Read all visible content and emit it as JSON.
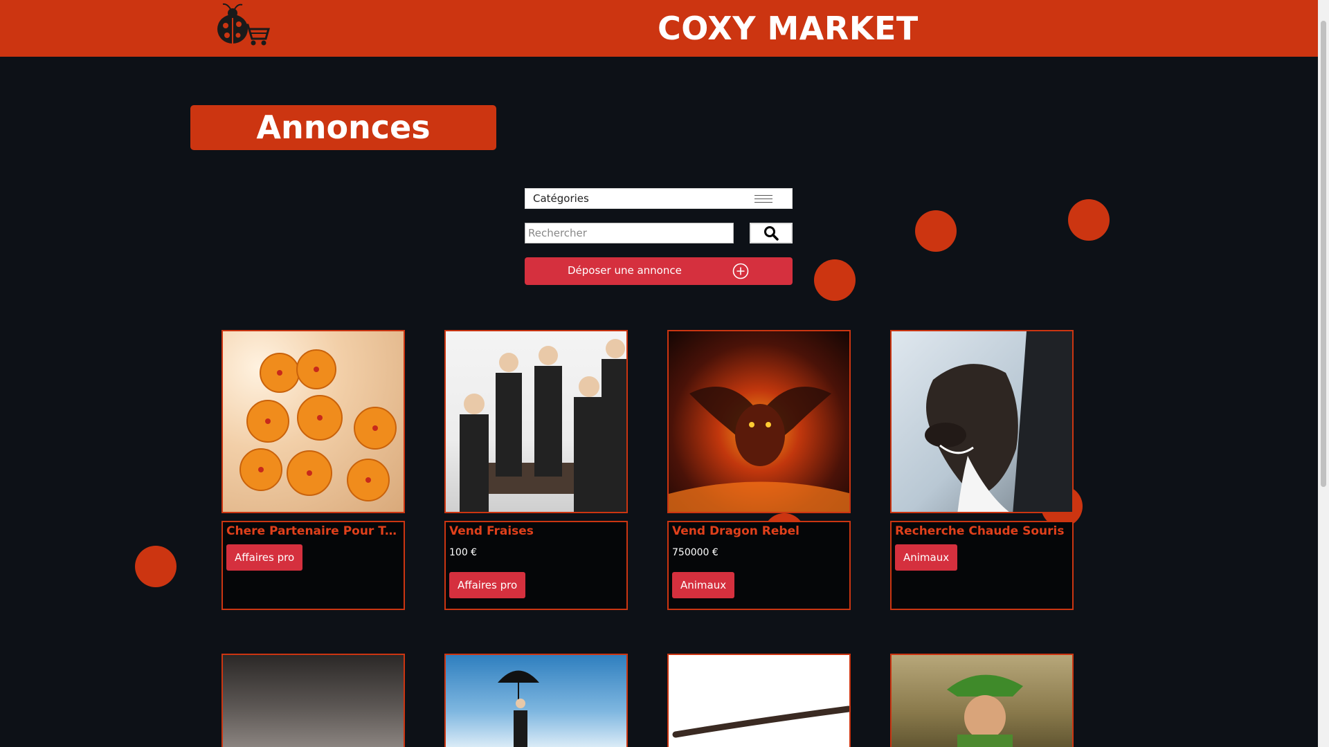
{
  "header": {
    "brand": "COXY MARKET"
  },
  "page": {
    "title": "Annonces"
  },
  "filters": {
    "category_label": "Catégories",
    "search_placeholder": "Rechercher",
    "post_button_label": "Déposer une annonce"
  },
  "listings": [
    {
      "title": "Chere Partenaire Pour Tro...",
      "price": "",
      "category": "Affaires pro",
      "image": "dragon-balls-photo"
    },
    {
      "title": "Vend Fraises",
      "price": "100 €",
      "category": "Affaires pro",
      "image": "business-meeting-photo"
    },
    {
      "title": "Vend Dragon Rebel",
      "price": "750000 €",
      "category": "Animaux",
      "image": "fire-dragon-artwork"
    },
    {
      "title": "Recherche Chaude Souris",
      "price": "",
      "category": "Animaux",
      "image": "dog-in-car-window-photo"
    }
  ],
  "listings_row2": [
    {
      "image": "dusty-car-photo"
    },
    {
      "image": "umbrella-sky-photo"
    },
    {
      "image": "wand-photo"
    },
    {
      "image": "green-hat-man-photo"
    }
  ],
  "colors": {
    "brand": "#cc3511",
    "button": "#d5303e",
    "background": "#0d1117"
  }
}
